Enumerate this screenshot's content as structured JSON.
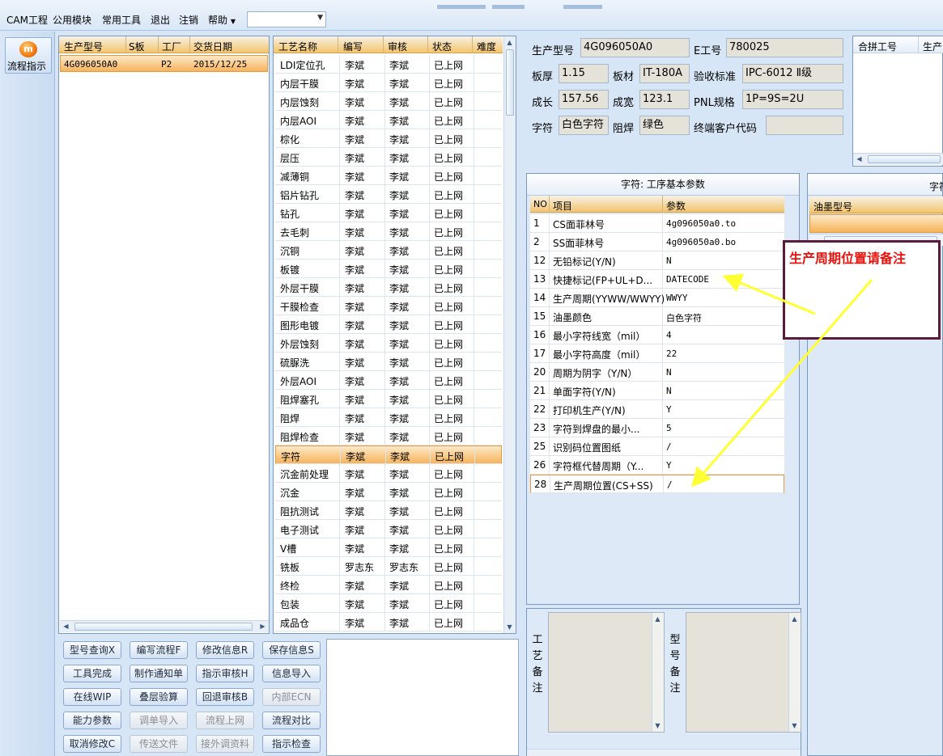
{
  "menu": {
    "items": [
      "CAM工程",
      "公用模块",
      "常用工具",
      "退出",
      "注销",
      "帮助"
    ],
    "combo_value": ""
  },
  "leftnav": {
    "flow_label": "流程指示"
  },
  "production_list": {
    "columns": [
      "生产型号",
      "S板",
      "工厂",
      "交货日期"
    ],
    "rows": [
      {
        "model": "4G096050A0",
        "s": "",
        "factory": "P2",
        "date": "2015/12/25"
      }
    ]
  },
  "process_table": {
    "columns": [
      "工艺名称",
      "编写",
      "审核",
      "状态",
      "难度"
    ],
    "selected_index": 21,
    "rows": [
      [
        "LDI定位孔",
        "李斌",
        "李斌",
        "已上网",
        ""
      ],
      [
        "内层干膜",
        "李斌",
        "李斌",
        "已上网",
        ""
      ],
      [
        "内层蚀刻",
        "李斌",
        "李斌",
        "已上网",
        ""
      ],
      [
        "内层AOI",
        "李斌",
        "李斌",
        "已上网",
        ""
      ],
      [
        "棕化",
        "李斌",
        "李斌",
        "已上网",
        ""
      ],
      [
        "层压",
        "李斌",
        "李斌",
        "已上网",
        ""
      ],
      [
        "减薄铜",
        "李斌",
        "李斌",
        "已上网",
        ""
      ],
      [
        "铝片钻孔",
        "李斌",
        "李斌",
        "已上网",
        ""
      ],
      [
        "钻孔",
        "李斌",
        "李斌",
        "已上网",
        ""
      ],
      [
        "去毛刺",
        "李斌",
        "李斌",
        "已上网",
        ""
      ],
      [
        "沉铜",
        "李斌",
        "李斌",
        "已上网",
        ""
      ],
      [
        "板镀",
        "李斌",
        "李斌",
        "已上网",
        ""
      ],
      [
        "外层干膜",
        "李斌",
        "李斌",
        "已上网",
        ""
      ],
      [
        "干膜检查",
        "李斌",
        "李斌",
        "已上网",
        ""
      ],
      [
        "图形电镀",
        "李斌",
        "李斌",
        "已上网",
        ""
      ],
      [
        "外层蚀刻",
        "李斌",
        "李斌",
        "已上网",
        ""
      ],
      [
        "硫脲洗",
        "李斌",
        "李斌",
        "已上网",
        ""
      ],
      [
        "外层AOI",
        "李斌",
        "李斌",
        "已上网",
        ""
      ],
      [
        "阻焊塞孔",
        "李斌",
        "李斌",
        "已上网",
        ""
      ],
      [
        "阻焊",
        "李斌",
        "李斌",
        "已上网",
        ""
      ],
      [
        "阻焊检查",
        "李斌",
        "李斌",
        "已上网",
        ""
      ],
      [
        "字符",
        "李斌",
        "李斌",
        "已上网",
        ""
      ],
      [
        "沉金前处理",
        "李斌",
        "李斌",
        "已上网",
        ""
      ],
      [
        "沉金",
        "李斌",
        "李斌",
        "已上网",
        ""
      ],
      [
        "阻抗测试",
        "李斌",
        "李斌",
        "已上网",
        ""
      ],
      [
        "电子测试",
        "李斌",
        "李斌",
        "已上网",
        ""
      ],
      [
        "V槽",
        "李斌",
        "李斌",
        "已上网",
        ""
      ],
      [
        "铣板",
        "罗志东",
        "罗志东",
        "已上网",
        ""
      ],
      [
        "终检",
        "李斌",
        "李斌",
        "已上网",
        ""
      ],
      [
        "包装",
        "李斌",
        "李斌",
        "已上网",
        ""
      ],
      [
        "成品仓",
        "李斌",
        "李斌",
        "已上网",
        ""
      ]
    ]
  },
  "buttons": [
    {
      "label": "型号查询X",
      "enabled": true
    },
    {
      "label": "编写流程F",
      "enabled": true
    },
    {
      "label": "修改信息R",
      "enabled": true
    },
    {
      "label": "保存信息S",
      "enabled": true
    },
    {
      "label": "工具完成",
      "enabled": true
    },
    {
      "label": "制作通知单",
      "enabled": true
    },
    {
      "label": "指示审核H",
      "enabled": true
    },
    {
      "label": "信息导入",
      "enabled": true
    },
    {
      "label": "在线WIP",
      "enabled": true
    },
    {
      "label": "叠层验算",
      "enabled": true
    },
    {
      "label": "回退审核B",
      "enabled": true
    },
    {
      "label": "内部ECN",
      "enabled": false
    },
    {
      "label": "能力参数",
      "enabled": true
    },
    {
      "label": "调单导入",
      "enabled": false
    },
    {
      "label": "流程上网",
      "enabled": false
    },
    {
      "label": "流程对比",
      "enabled": true
    },
    {
      "label": "取消修改C",
      "enabled": true
    },
    {
      "label": "传送文件",
      "enabled": false
    },
    {
      "label": "接外调资料",
      "enabled": false
    },
    {
      "label": "指示检查",
      "enabled": true
    }
  ],
  "info": {
    "model_label": "生产型号",
    "model": "4G096050A0",
    "eno_label": "E工号",
    "eno": "780025",
    "thickness_label": "板厚",
    "thickness": "1.15",
    "material_label": "板材",
    "material": "IT-180A",
    "standard_label": "验收标准",
    "standard": "IPC-6012 Ⅱ级",
    "length_label": "成长",
    "length": "157.56",
    "width_label": "成宽",
    "width": "123.1",
    "pnl_label": "PNL规格",
    "pnl": "1P=9S=2U",
    "char_label": "字符",
    "char": "白色字符",
    "mask_label": "阻焊",
    "mask": "绿色",
    "customer_label": "终端客户代码",
    "customer": ""
  },
  "merge_panel": {
    "columns": [
      "合拼工号",
      "生产"
    ]
  },
  "params": {
    "title": "字符: 工序基本参数",
    "columns": [
      "NO",
      "项目",
      "参数"
    ],
    "selected_index": 15,
    "rows": [
      [
        "1",
        "CS面菲林号",
        "4g096050a0.to"
      ],
      [
        "2",
        "SS面菲林号",
        "4g096050a0.bo"
      ],
      [
        "12",
        "无铅标记(Y/N)",
        "N"
      ],
      [
        "13",
        "快捷标记(FP+UL+D...",
        "DATECODE"
      ],
      [
        "14",
        "生产周期(YYWW/WWYY)",
        "WWYY"
      ],
      [
        "15",
        "油墨颜色",
        "白色字符"
      ],
      [
        "16",
        "最小字符线宽（mil）",
        "4"
      ],
      [
        "17",
        "最小字符高度（mil）",
        "22"
      ],
      [
        "20",
        "周期为阴字（Y/N）",
        "N"
      ],
      [
        "21",
        "单面字符(Y/N)",
        "N"
      ],
      [
        "22",
        "打印机生产(Y/N)",
        "Y"
      ],
      [
        "23",
        "字符到焊盘的最小...",
        "5"
      ],
      [
        "25",
        "识别码位置图纸",
        "/"
      ],
      [
        "26",
        "字符框代替周期（Y...",
        "Y"
      ],
      [
        "28",
        "生产周期位置(CS+SS)",
        "/"
      ]
    ]
  },
  "ink_panel": {
    "title": "字符",
    "column": "油墨型号"
  },
  "memos": {
    "process_label": [
      "工",
      "艺",
      "备",
      "注"
    ],
    "model_label": [
      "型",
      "号",
      "备",
      "注"
    ]
  },
  "annotation": {
    "text": "生产周期位置请备注",
    "color": "#e8120c",
    "arrow_color": "#ffff33"
  }
}
